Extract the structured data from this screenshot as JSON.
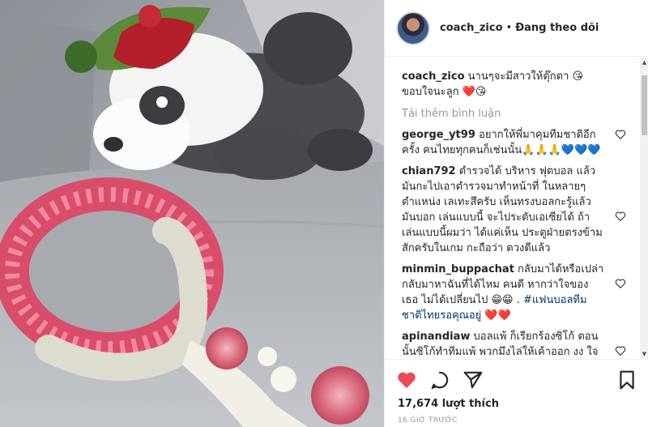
{
  "header": {
    "username": "coach_zico",
    "separator": "•",
    "follow_label": "Đang theo dõi"
  },
  "caption": {
    "username": "coach_zico",
    "text": "นานๆจะมีสาวให้ตุ๊กตา 😘 ขอบใจนะลูก ❤️😘"
  },
  "load_more_label": "Tải thêm bình luận",
  "comments": [
    {
      "username": "george_yt99",
      "text": "อยากให้พี่มาคุมทีมชาติอีกครั้ง คนไทยทุกคนก็เช่นนั้น🙏🙏🙏💙💙💙"
    },
    {
      "username": "chian792",
      "text": "ตำรวจได้ บริหาร ฟุตบอล แล้วมันกะไปเอาตำรวจมาทำหน้าที่ ในหลายๆตำแหน่ง เลเทะสึครับ เห็นทรงบอลกะรู้แล้ว มันบอก เล่นแบบนี้ จะไประดับเอเซียได้ ถ้าเล่นแบบนี้ผมว่า ได้แค่เห็น ประตูฝ่ายตรงข้ามสักครับในเกม กะถือว่า ดวงดีแล้ว"
    },
    {
      "username": "minmin_buppachat",
      "text": "กลับมาได้หรือเปล่า กลับมาหาฉันที่ได้ไหม คนดี หากว่าใจของเธอ ไม่ได้เปลี่ยนไป 😁😁 .",
      "hashtag": "#แฟนบอลทีมชาติไทยรอคุณอยู่",
      "emoji": "❤️❤️"
    },
    {
      "username": "apinandiaw",
      "text": "บอลแพ้ ก็เรียกร้องซิโก้ ตอนนั้นซิโก้ทำทีมแพ้ พวกมึงไล่ให้เค้าออก งง ใจพวกมึงจริงๆ"
    }
  ],
  "likes_text": "17,674 lượt thích",
  "time_text": "16 GIỜ TRƯỚC",
  "icons": {
    "like": "heart-filled-icon",
    "comment": "comment-bubble-icon",
    "share": "share-plane-icon",
    "save": "bookmark-icon",
    "comment_like": "heart-outline-icon"
  },
  "colors": {
    "like_red": "#ed4956",
    "hashtag_blue": "#003569",
    "muted": "#999999"
  }
}
